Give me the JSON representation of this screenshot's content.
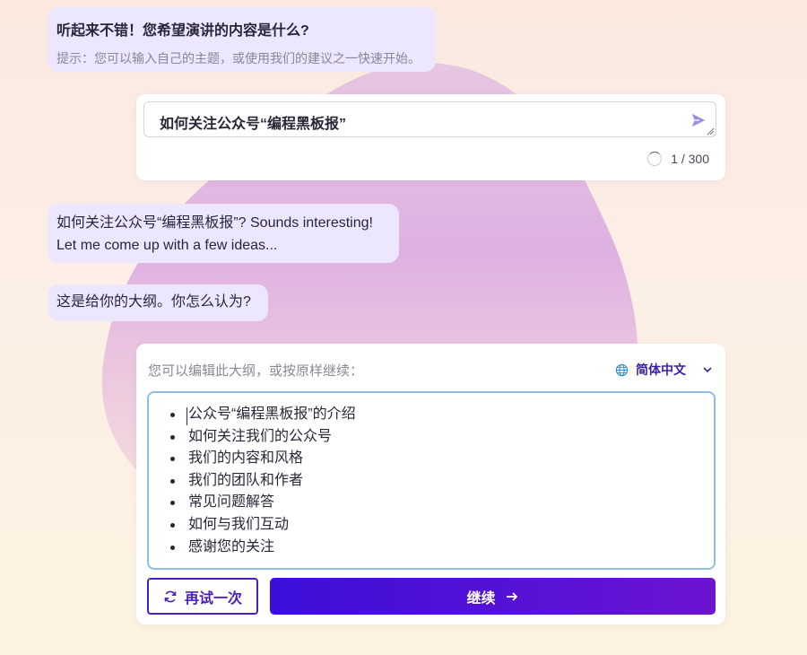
{
  "messages": {
    "ask_topic": "听起来不错！您希望演讲的内容是什么?",
    "hint": "提示：您可以输入自己的主题，或使用我们的建议之一快速开始。",
    "echo_line1": "如何关注公众号“编程黑板报”? Sounds interesting!",
    "echo_line2": "Let me come up with a few ideas...",
    "outline_intro": "这是给你的大纲。你怎么认为?"
  },
  "topic_input": {
    "value": "如何关注公众号“编程黑板报”",
    "counter": "1 / 300",
    "send_icon": "send-icon"
  },
  "outline_card": {
    "hint": "您可以编辑此大纲，或按原样继续：",
    "language": "简体中文",
    "items": [
      "公众号“编程黑板报”的介绍",
      "如何关注我们的公众号",
      "我们的内容和风格",
      "我们的团队和作者",
      "常见问题解答",
      "如何与我们互动",
      "感谢您的关注"
    ],
    "retry_label": "再试一次",
    "continue_label": "继续"
  },
  "colors": {
    "bubble": "#ece6ff",
    "accent": "#4c1dbf",
    "continue_gradient_start": "#3b0fd8",
    "continue_gradient_end": "#6c14d0",
    "editor_border": "#8fbde4"
  }
}
